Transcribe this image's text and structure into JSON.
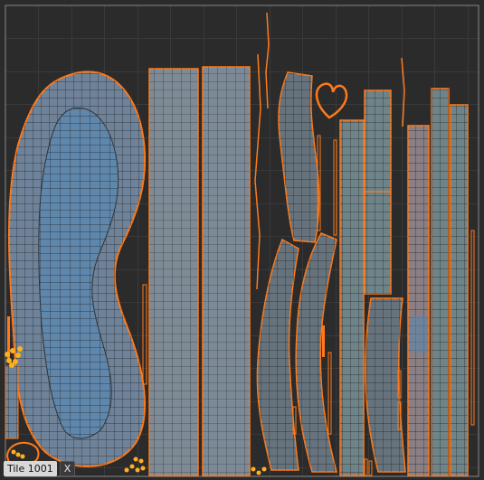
{
  "tile": {
    "label": "Tile 1001",
    "close_label": "X"
  },
  "colors": {
    "background": "#2b2b2b",
    "grid": "#4a4a4a",
    "tile_border": "#8a8a8a",
    "uv_fill_blue": "#6e8fa6",
    "uv_fill_rose": "#8f7f80",
    "uv_fill_teal": "#6f8c8c",
    "wire": "#2a2a2a",
    "seam": "#ff7a1a",
    "pin": "#ffb020"
  },
  "icons": {
    "pin_cluster": "uv-pin-cluster-icon"
  }
}
